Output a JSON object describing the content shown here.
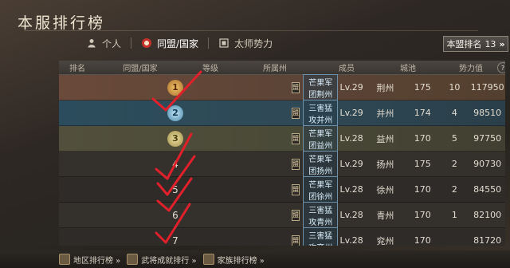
{
  "title": "本服排行榜",
  "tabs": [
    {
      "label": "个人",
      "icon": "person-icon"
    },
    {
      "label": "同盟/国家",
      "icon": "alliance-icon",
      "active": true
    },
    {
      "label": "太师势力",
      "icon": "faction-icon"
    }
  ],
  "my_rank": {
    "label": "本盟排名",
    "value": "13",
    "arrow": "»"
  },
  "table": {
    "headers": [
      "排名",
      "同盟/国家",
      "等级",
      "所属州",
      "成员",
      "城池",
      "势力值"
    ],
    "rows": [
      {
        "rank": "1",
        "guild": "芒果军团荆州",
        "level": "Lv.29",
        "state": "荆州",
        "members": "175",
        "cities": "10",
        "power": "117950"
      },
      {
        "rank": "2",
        "guild": "三害猛攻并州",
        "level": "Lv.29",
        "state": "并州",
        "members": "174",
        "cities": "4",
        "power": "98510"
      },
      {
        "rank": "3",
        "guild": "芒果军团益州",
        "level": "Lv.28",
        "state": "益州",
        "members": "170",
        "cities": "5",
        "power": "97750"
      },
      {
        "rank": "4",
        "guild": "芒果军团扬州",
        "level": "Lv.29",
        "state": "扬州",
        "members": "175",
        "cities": "2",
        "power": "90730"
      },
      {
        "rank": "5",
        "guild": "芒果军团徐州",
        "level": "Lv.28",
        "state": "徐州",
        "members": "170",
        "cities": "2",
        "power": "84550"
      },
      {
        "rank": "6",
        "guild": "三害猛攻青州",
        "level": "Lv.28",
        "state": "青州",
        "members": "170",
        "cities": "1",
        "power": "82100"
      },
      {
        "rank": "7",
        "guild": "三害猛攻兖州",
        "level": "Lv.28",
        "state": "兖州",
        "members": "170",
        "cities": "",
        "power": "81720"
      }
    ]
  },
  "bottom_nav": [
    "地区排行榜 »",
    "武将成就排行 »",
    "家族排行榜 »"
  ],
  "colors": {
    "annotation_check": "#e0202a"
  }
}
